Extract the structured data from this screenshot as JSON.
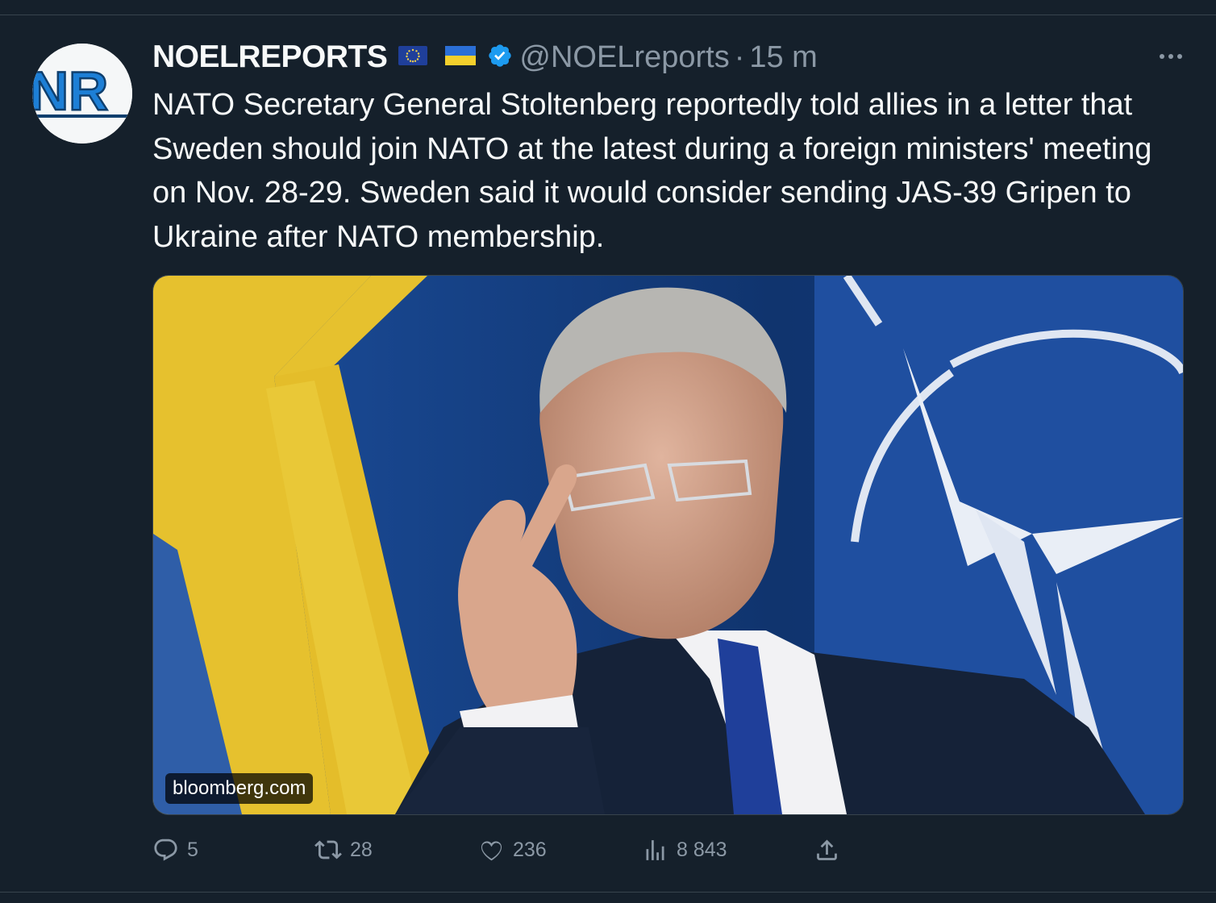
{
  "tweet": {
    "author_name": "NOELREPORTS",
    "handle": "@NOELreports",
    "separator": "·",
    "time": "15 m",
    "text": "NATO Secretary General Stoltenberg reportedly told allies in a letter that Sweden should join NATO at the latest during a foreign ministers' meeting on Nov. 28-29. Sweden said it would consider sending JAS-39 Gripen to Ukraine after NATO membership.",
    "avatar_initials": "NR",
    "badges": [
      "eu-flag-icon",
      "ukraine-flag-icon",
      "verified-badge-icon"
    ],
    "media": {
      "source_label": "bloomberg.com",
      "description_icons": [
        "sweden-flag",
        "nato-flag"
      ]
    },
    "stats": {
      "replies": "5",
      "retweets": "28",
      "likes": "236",
      "views": "8 843"
    }
  },
  "colors": {
    "background": "#15202b",
    "text": "#f7f9f9",
    "muted": "#8b98a5",
    "verified": "#1d9bf0",
    "divider": "#38444d"
  }
}
